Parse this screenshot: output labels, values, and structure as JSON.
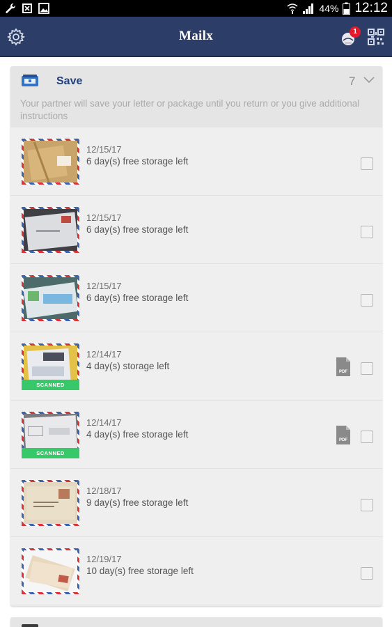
{
  "status_bar": {
    "battery_percent": "44%",
    "time": "12:12",
    "icons": [
      "wrench-icon",
      "notification-x-icon",
      "image-icon",
      "wifi-icon",
      "signal-icon",
      "battery-icon"
    ]
  },
  "app_bar": {
    "title": "Mailx",
    "notification_count": "1",
    "left_icon": "gear-icon",
    "right_icons": [
      "notification-icon",
      "qr-code-icon"
    ]
  },
  "save_section": {
    "icon": "mailbox-icon",
    "title": "Save",
    "count": "7",
    "description": "Your partner will save your letter or package until you return or you give additional instructions",
    "items": [
      {
        "date": "12/15/17",
        "text": "6 day(s) free storage left",
        "scanned": false,
        "pdf": false
      },
      {
        "date": "12/15/17",
        "text": "6 day(s) free storage left",
        "scanned": false,
        "pdf": false
      },
      {
        "date": "12/15/17",
        "text": "6 day(s) free storage left",
        "scanned": false,
        "pdf": false
      },
      {
        "date": "12/14/17",
        "text": "4 day(s) storage left",
        "scanned": true,
        "scanned_label": "SCANNED",
        "pdf": true
      },
      {
        "date": "12/14/17",
        "text": "4 day(s) free storage left",
        "scanned": true,
        "scanned_label": "SCANNED",
        "pdf": true
      },
      {
        "date": "12/18/17",
        "text": "9 day(s) free storage left",
        "scanned": false,
        "pdf": false
      },
      {
        "date": "12/19/17",
        "text": "10 day(s) free storage left",
        "scanned": false,
        "pdf": false
      }
    ]
  },
  "colors": {
    "app_bar": "#2c3e67",
    "section_title": "#22407a",
    "scanned_badge": "#37c86a",
    "notification_badge": "#e5192c"
  }
}
